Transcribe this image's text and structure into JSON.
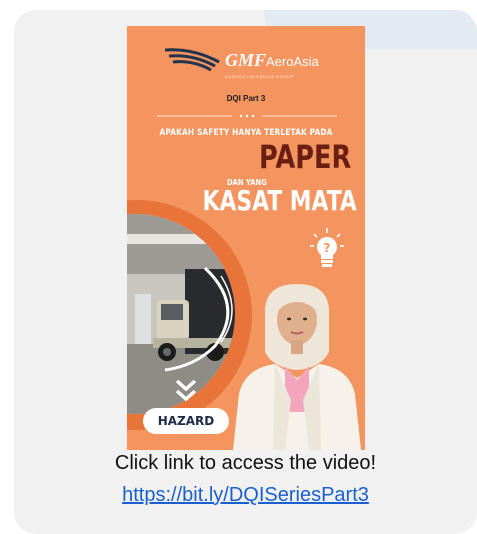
{
  "poster": {
    "brand": "GMF",
    "brand_suffix": "AeroAsia",
    "tagline": "GARUDA INDONESIA GROUP",
    "part": "DQI Part 3",
    "question": "APAKAH SAFETY HANYA TERLETAK PADA",
    "word_paper": "PAPER",
    "dan_yang": "DAN YANG",
    "kasat_mata": "KASAT MATA",
    "hazard_button": "HAZARD",
    "colors": {
      "background": "#f4955f",
      "paper_text": "#6a1f12",
      "accent": "#e8743a"
    }
  },
  "caption": "Click link to access the video!",
  "link": "https://bit.ly/DQISeriesPart3",
  "icons": [
    "logo-wings-icon",
    "lightbulb-question-icon",
    "double-chevron-down-icon"
  ]
}
